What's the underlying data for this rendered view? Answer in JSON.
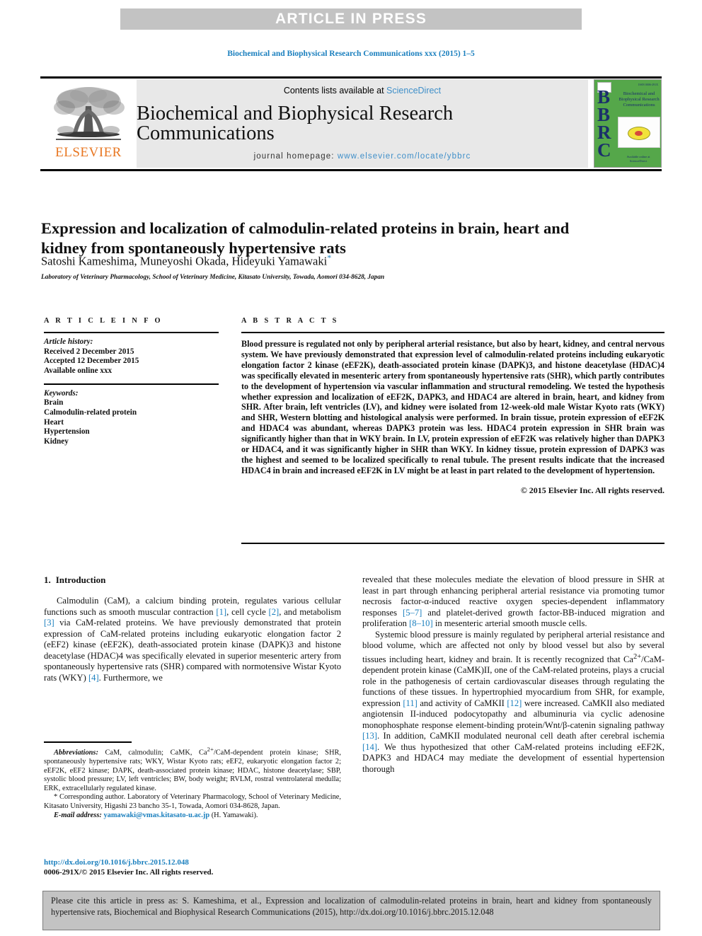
{
  "banner": {
    "text": "ARTICLE IN PRESS"
  },
  "running_head": "Biochemical and Biophysical Research Communications xxx (2015) 1–5",
  "masthead": {
    "publisher": "ELSEVIER",
    "contents_prefix": "Contents lists available at ",
    "contents_link": "ScienceDirect",
    "journal_title": "Biochemical and Biophysical Research Communications",
    "homepage_label": "journal homepage: ",
    "homepage_url": "www.elsevier.com/locate/ybbrc",
    "cover": {
      "letters": "BBRC",
      "title": "Biochemical and Biophysical Research Communications",
      "footer": "Available online at ScienceDirect",
      "issn": "ISSN 0006-291X"
    }
  },
  "article": {
    "title": "Expression and localization of calmodulin-related proteins in brain, heart and kidney from spontaneously hypertensive rats",
    "authors": "Satoshi Kameshima, Muneyoshi Okada, Hideyuki Yamawaki",
    "corresponding_marker": "*",
    "affiliation": "Laboratory of Veterinary Pharmacology, School of Veterinary Medicine, Kitasato University, Towada, Aomori 034-8628, Japan"
  },
  "article_info": {
    "heading": "A R T I C L E   I N F O",
    "history_label": "Article history:",
    "history": [
      "Received 2 December 2015",
      "Accepted 12 December 2015",
      "Available online xxx"
    ],
    "keywords_label": "Keywords:",
    "keywords": [
      "Brain",
      "Calmodulin-related protein",
      "Heart",
      "Hypertension",
      "Kidney"
    ]
  },
  "abstract": {
    "heading": "A B S T R A C T S",
    "text": "Blood pressure is regulated not only by peripheral arterial resistance, but also by heart, kidney, and central nervous system. We have previously demonstrated that expression level of calmodulin-related proteins including eukaryotic elongation factor 2 kinase (eEF2K), death-associated protein kinase (DAPK)3, and histone deacetylase (HDAC)4 was specifically elevated in mesenteric artery from spontaneously hypertensive rats (SHR), which partly contributes to the development of hypertension via vascular inflammation and structural remodeling. We tested the hypothesis whether expression and localization of eEF2K, DAPK3, and HDAC4 are altered in brain, heart, and kidney from SHR. After brain, left ventricles (LV), and kidney were isolated from 12-week-old male Wistar Kyoto rats (WKY) and SHR, Western blotting and histological analysis were performed. In brain tissue, protein expression of eEF2K and HDAC4 was abundant, whereas DAPK3 protein was less. HDAC4 protein expression in SHR brain was significantly higher than that in WKY brain. In LV, protein expression of eEF2K was relatively higher than DAPK3 or HDAC4, and it was significantly higher in SHR than WKY. In kidney tissue, protein expression of DAPK3 was the highest and seemed to be localized specifically to renal tubule. The present results indicate that the increased HDAC4 in brain and increased eEF2K in LV might be at least in part related to the development of hypertension.",
    "copyright": "© 2015 Elsevier Inc. All rights reserved."
  },
  "introduction": {
    "number": "1.",
    "heading": "Introduction",
    "left_paragraph_1_pre": "Calmodulin (CaM), a calcium binding protein, regulates various cellular functions such as smooth muscular contraction ",
    "ref1": "[1]",
    "left_paragraph_1_mid1": ", cell cycle ",
    "ref2": "[2]",
    "left_paragraph_1_mid2": ", and metabolism ",
    "ref3": "[3]",
    "left_paragraph_1_mid3": " via CaM-related proteins. We have previously demonstrated that protein expression of CaM-related proteins including eukaryotic elongation factor 2 (eEF2) kinase (eEF2K), death-associated protein kinase (DAPK)3 and histone deacetylase (HDAC)4 was specifically elevated in superior mesenteric artery from spontaneously hypertensive rats (SHR) compared with normotensive Wistar Kyoto rats (WKY) ",
    "ref4": "[4]",
    "left_paragraph_1_end": ". Furthermore, we",
    "right_paragraph_1_pre": "revealed that these molecules mediate the elevation of blood pressure in SHR at least in part through enhancing peripheral arterial resistance via promoting tumor necrosis factor-α-induced reactive oxygen species-dependent inflammatory responses ",
    "ref5_7": "[5–7]",
    "right_paragraph_1_mid": " and platelet-derived growth factor-BB-induced migration and proliferation ",
    "ref8_10": "[8–10]",
    "right_paragraph_1_end": " in mesenteric arterial smooth muscle cells.",
    "right_paragraph_2_pre": "Systemic blood pressure is mainly regulated by peripheral arterial resistance and blood volume, which are affected not only by blood vessel but also by several tissues including heart, kidney and brain. It is recently recognized that Ca",
    "sup_2plus": "2+",
    "right_paragraph_2_mid1": "/CaM-dependent protein kinase (CaMK)II, one of the CaM-related proteins, plays a crucial role in the pathogenesis of certain cardiovascular diseases through regulating the functions of these tissues. In hypertrophied myocardium from SHR, for example, expression ",
    "ref11": "[11]",
    "right_paragraph_2_mid2": " and activity of CaMKII ",
    "ref12": "[12]",
    "right_paragraph_2_mid3": " were increased. CaMKII also mediated angiotensin II-induced podocytopathy and albuminuria via cyclic adenosine monophosphate response element-binding protein/Wnt/β-catenin signaling pathway ",
    "ref13": "[13]",
    "right_paragraph_2_mid4": ". In addition, CaMKII modulated neuronal cell death after cerebral ischemia ",
    "ref14": "[14]",
    "right_paragraph_2_end": ". We thus hypothesized that other CaM-related proteins including eEF2K, DAPK3 and HDAC4 may mediate the development of essential hypertension thorough"
  },
  "footnotes": {
    "abbreviations_label": "Abbreviations:",
    "abbreviations_pre": " CaM, calmodulin; CaMK, Ca",
    "abbreviations_sup": "2+",
    "abbreviations_post": "/CaM-dependent protein kinase; SHR, spontaneously hypertensive rats; WKY, Wistar Kyoto rats; eEF2, eukaryotic elongation factor 2; eEF2K, eEF2 kinase; DAPK, death-associated protein kinase; HDAC, histone deacetylase; SBP, systolic blood pressure; LV, left ventricles; BW, body weight; RVLM, rostral ventrolateral medulla; ERK, extracellularly regulated kinase.",
    "corresponding_marker": "*",
    "corresponding": " Corresponding author. Laboratory of Veterinary Pharmacology, School of Veterinary Medicine, Kitasato University, Higashi 23 bancho 35-1, Towada, Aomori 034-8628, Japan.",
    "email_label": "E-mail address:",
    "email": "yamawaki@vmas.kitasato-u.ac.jp",
    "email_owner": " (H. Yamawaki)."
  },
  "doi_block": {
    "doi": "http://dx.doi.org/10.1016/j.bbrc.2015.12.048",
    "issn_line": "0006-291X/© 2015 Elsevier Inc. All rights reserved."
  },
  "cite_box": {
    "text": "Please cite this article in press as: S. Kameshima, et al., Expression and localization of calmodulin-related proteins in brain, heart and kidney from spontaneously hypertensive rats, Biochemical and Biophysical Research Communications (2015), http://dx.doi.org/10.1016/j.bbrc.2015.12.048"
  },
  "colors": {
    "link": "#1a7fbe",
    "banner_bg": "#c3c3c3",
    "masthead_bg": "#e8e8e8",
    "elsevier_orange": "#e87722",
    "cover_green": "#55a74a",
    "cover_navy": "#1b2f6b"
  }
}
